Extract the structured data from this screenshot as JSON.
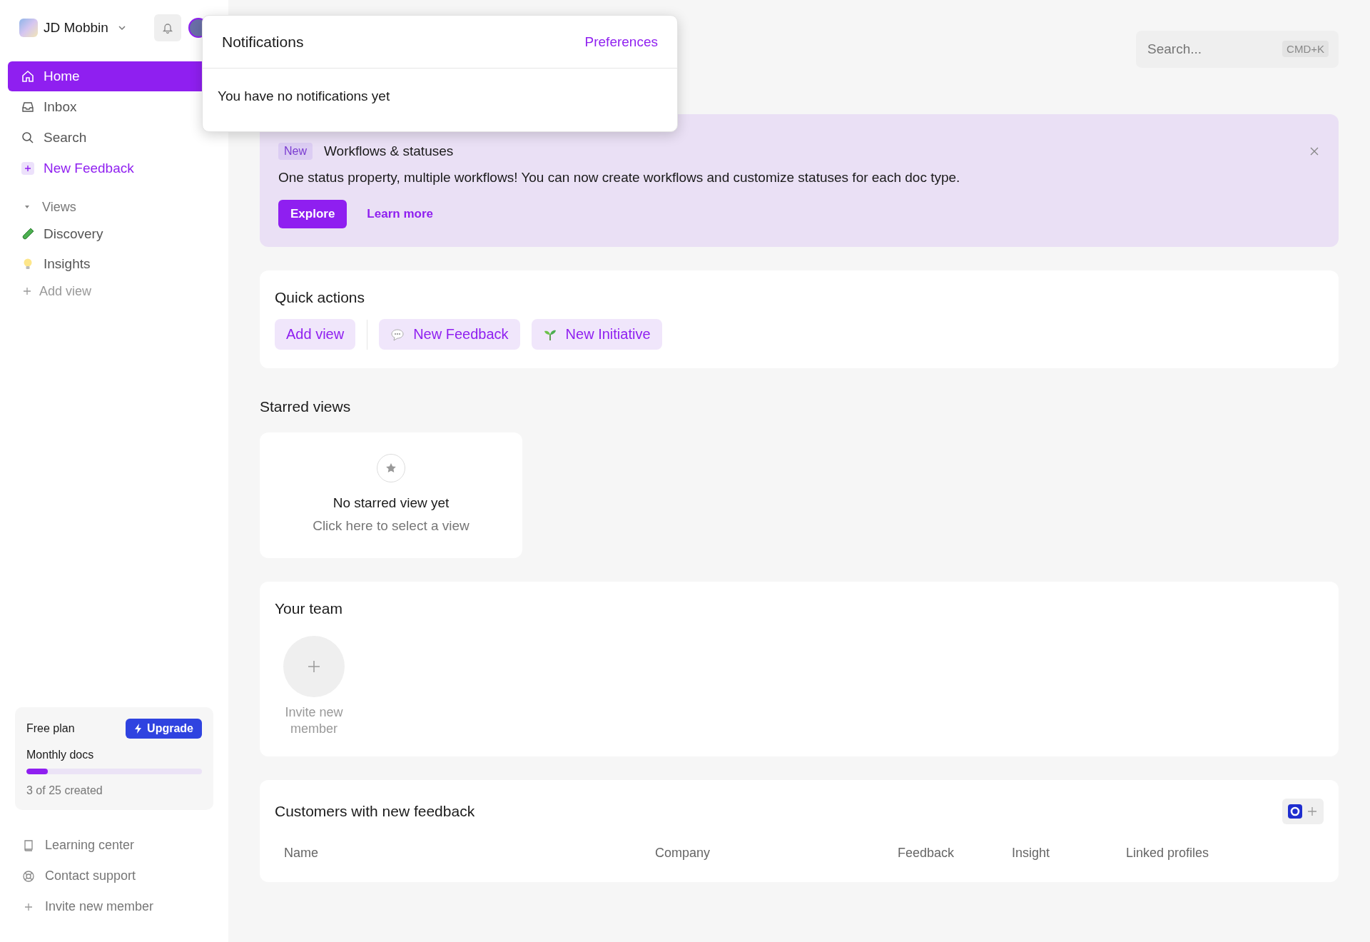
{
  "workspace": {
    "name": "JD Mobbin"
  },
  "sidebar": {
    "nav": [
      {
        "label": "Home",
        "selected": true
      },
      {
        "label": "Inbox",
        "selected": false
      },
      {
        "label": "Search",
        "selected": false
      },
      {
        "label": "New Feedback",
        "selected": false
      }
    ],
    "views_label": "Views",
    "views": [
      "Discovery",
      "Insights"
    ],
    "add_view": "Add view",
    "plan": {
      "name": "Free plan",
      "upgrade": "Upgrade",
      "metric": "Monthly docs",
      "level": 0.12,
      "usage": "3 of 25 created"
    },
    "footer": [
      "Learning center",
      "Contact support",
      "Invite new member"
    ]
  },
  "notifications": {
    "title": "Notifications",
    "preferences": "Preferences",
    "empty": "You have no notifications yet"
  },
  "search": {
    "placeholder": "Search...",
    "shortcut": "CMD+K"
  },
  "banner": {
    "badge": "New",
    "title": "Workflows & statuses",
    "text": "One status property, multiple workflows! You can now create workflows and customize statuses for each doc type.",
    "primary": "Explore",
    "secondary": "Learn more"
  },
  "quick_actions": {
    "title": "Quick actions",
    "items": [
      "Add view",
      "New Feedback",
      "New Initiative"
    ]
  },
  "starred": {
    "title": "Starred views",
    "empty_title": "No starred view yet",
    "empty_hint": "Click here to select a view"
  },
  "team": {
    "title": "Your team",
    "invite": "Invite new member"
  },
  "customers": {
    "title": "Customers with new feedback",
    "columns": [
      "Name",
      "Company",
      "Feedback",
      "Insight",
      "Linked profiles"
    ]
  }
}
